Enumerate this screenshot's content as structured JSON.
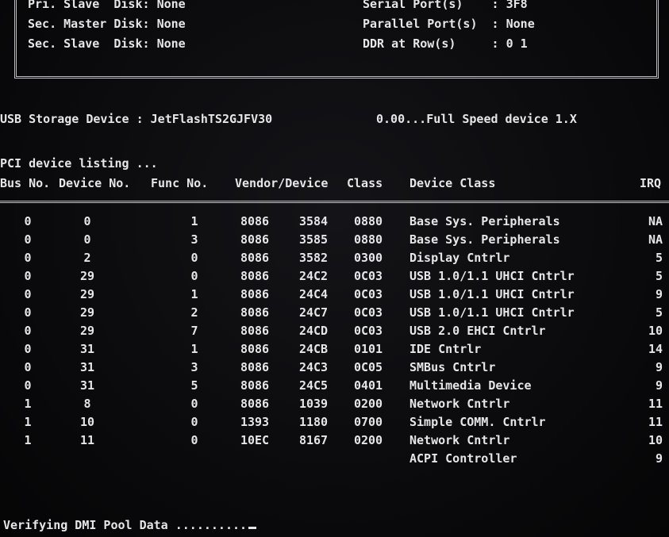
{
  "summary": {
    "left": [
      {
        "label": "Pri. Slave  Disk",
        "value": "None"
      },
      {
        "label": "Sec. Master Disk",
        "value": "None"
      },
      {
        "label": "Sec. Slave  Disk",
        "value": "None"
      }
    ],
    "right": [
      {
        "label": "Serial Port(s)  ",
        "value": "3F8"
      },
      {
        "label": "Parallel Port(s)",
        "value": "None"
      },
      {
        "label": "DDR at Row(s)   ",
        "value": "0 1"
      }
    ]
  },
  "usb": {
    "label": "USB Storage Device : JetFlashTS2GJFV30",
    "speed": "0.00...Full Speed device 1.X"
  },
  "pci": {
    "heading": "PCI device listing ...",
    "headers": {
      "bus": "Bus No.",
      "device": "Device No.",
      "func": "Func No.",
      "vendor_device": "Vendor/Device",
      "class": "Class",
      "device_class": "Device Class",
      "irq": "IRQ"
    },
    "rows": [
      {
        "bus": "0",
        "device": "0",
        "func": "1",
        "vendor": "8086",
        "devid": "3584",
        "class": "0880",
        "name": "Base Sys. Peripherals",
        "irq": "NA"
      },
      {
        "bus": "0",
        "device": "0",
        "func": "3",
        "vendor": "8086",
        "devid": "3585",
        "class": "0880",
        "name": "Base Sys. Peripherals",
        "irq": "NA"
      },
      {
        "bus": "0",
        "device": "2",
        "func": "0",
        "vendor": "8086",
        "devid": "3582",
        "class": "0300",
        "name": "Display Cntrlr",
        "irq": "5"
      },
      {
        "bus": "0",
        "device": "29",
        "func": "0",
        "vendor": "8086",
        "devid": "24C2",
        "class": "0C03",
        "name": "USB 1.0/1.1 UHCI Cntrlr",
        "irq": "5"
      },
      {
        "bus": "0",
        "device": "29",
        "func": "1",
        "vendor": "8086",
        "devid": "24C4",
        "class": "0C03",
        "name": "USB 1.0/1.1 UHCI Cntrlr",
        "irq": "9"
      },
      {
        "bus": "0",
        "device": "29",
        "func": "2",
        "vendor": "8086",
        "devid": "24C7",
        "class": "0C03",
        "name": "USB 1.0/1.1 UHCI Cntrlr",
        "irq": "5"
      },
      {
        "bus": "0",
        "device": "29",
        "func": "7",
        "vendor": "8086",
        "devid": "24CD",
        "class": "0C03",
        "name": "USB 2.0 EHCI Cntrlr",
        "irq": "10"
      },
      {
        "bus": "0",
        "device": "31",
        "func": "1",
        "vendor": "8086",
        "devid": "24CB",
        "class": "0101",
        "name": "IDE Cntrlr",
        "irq": "14"
      },
      {
        "bus": "0",
        "device": "31",
        "func": "3",
        "vendor": "8086",
        "devid": "24C3",
        "class": "0C05",
        "name": "SMBus Cntrlr",
        "irq": "9"
      },
      {
        "bus": "0",
        "device": "31",
        "func": "5",
        "vendor": "8086",
        "devid": "24C5",
        "class": "0401",
        "name": "Multimedia Device",
        "irq": "9"
      },
      {
        "bus": "1",
        "device": "8",
        "func": "0",
        "vendor": "8086",
        "devid": "1039",
        "class": "0200",
        "name": "Network Cntrlr",
        "irq": "11"
      },
      {
        "bus": "1",
        "device": "10",
        "func": "0",
        "vendor": "1393",
        "devid": "1180",
        "class": "0700",
        "name": "Simple COMM. Cntrlr",
        "irq": "11"
      },
      {
        "bus": "1",
        "device": "11",
        "func": "0",
        "vendor": "10EC",
        "devid": "8167",
        "class": "0200",
        "name": "Network Cntrlr",
        "irq": "10"
      },
      {
        "bus": "",
        "device": "",
        "func": "",
        "vendor": "",
        "devid": "",
        "class": "",
        "name": "ACPI Controller",
        "irq": "9"
      }
    ]
  },
  "status": {
    "verify_text": "Verifying DMI Pool Data .........."
  }
}
